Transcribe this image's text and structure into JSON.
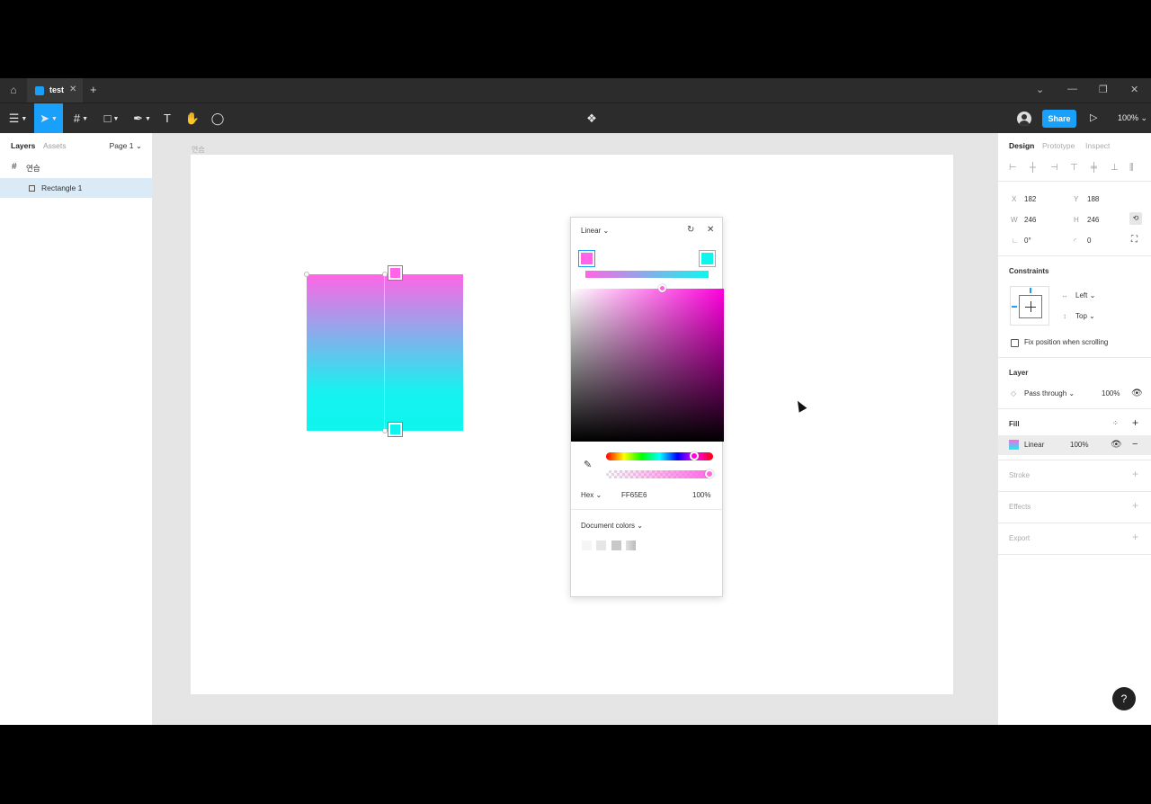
{
  "titlebar": {
    "tab_name": "test",
    "new_tab": "+"
  },
  "toolbar": {
    "share_label": "Share",
    "zoom_label": "100%"
  },
  "left_panel": {
    "tabs": [
      "Layers",
      "Assets"
    ],
    "page_selector": "Page 1",
    "layers": [
      {
        "name": "연습",
        "icon": "frame-icon"
      },
      {
        "name": "Rectangle 1",
        "icon": "rectangle-icon",
        "selected": true
      }
    ]
  },
  "canvas": {
    "frame_label": "연습",
    "gradient_start": "#FF65E6",
    "gradient_end": "#0FF5EE"
  },
  "color_picker": {
    "fill_type": "Linear",
    "color_model": "Hex",
    "hex_value": "FF65E6",
    "opacity": "100%",
    "document_colors_label": "Document colors",
    "document_colors": [
      "#f5f5f5",
      "#e6e6e6",
      "#c8c8c8",
      "#d0d0d0"
    ]
  },
  "right_panel": {
    "tabs": [
      "Design",
      "Prototype",
      "Inspect"
    ],
    "position": {
      "x_label": "X",
      "x": "182",
      "y_label": "Y",
      "y": "188"
    },
    "size": {
      "w_label": "W",
      "w": "246",
      "h_label": "H",
      "h": "246"
    },
    "rotation": "0°",
    "corner_radius": "0",
    "constraints_title": "Constraints",
    "constraint_h": "Left",
    "constraint_v": "Top",
    "fix_position_label": "Fix position when scrolling",
    "layer_title": "Layer",
    "blend_mode": "Pass through",
    "layer_opacity": "100%",
    "fill_title": "Fill",
    "fill_type": "Linear",
    "fill_opacity": "100%",
    "stroke_title": "Stroke",
    "effects_title": "Effects",
    "export_title": "Export"
  },
  "help_label": "?"
}
